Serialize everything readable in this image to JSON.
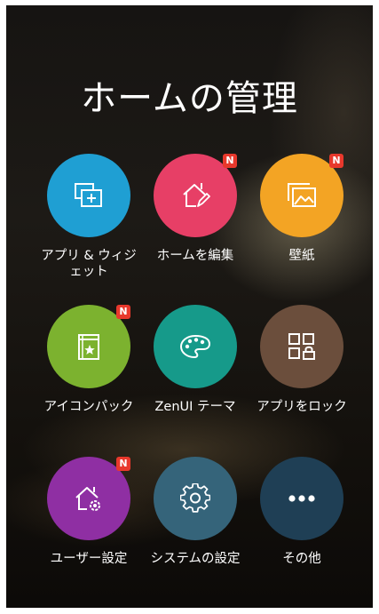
{
  "title": "ホームの管理",
  "badge_text": "N",
  "colors": {
    "apps_widgets": "#1f9fd3",
    "edit_home": "#e73f66",
    "wallpaper": "#f3a424",
    "icon_pack": "#7cb22f",
    "zenui_theme": "#169a8a",
    "lock_apps": "#6b4e3c",
    "user_settings": "#8f2fa3",
    "system_settings": "#35647a",
    "more": "#1f3f55",
    "badge": "#e8382c"
  },
  "tiles": [
    {
      "label": "アプリ & ウィジェット",
      "icon": "add-window-icon",
      "badge": false
    },
    {
      "label": "ホームを編集",
      "icon": "home-edit-icon",
      "badge": true
    },
    {
      "label": "壁紙",
      "icon": "wallpaper-icon",
      "badge": true
    },
    {
      "label": "アイコンパック",
      "icon": "icon-pack-book-icon",
      "badge": true
    },
    {
      "label": "ZenUI テーマ",
      "icon": "palette-icon",
      "badge": false
    },
    {
      "label": "アプリをロック",
      "icon": "grid-lock-icon",
      "badge": false
    },
    {
      "label": "ユーザー設定",
      "icon": "home-gear-icon",
      "badge": true
    },
    {
      "label": "システムの設定",
      "icon": "gear-icon",
      "badge": false
    },
    {
      "label": "その他",
      "icon": "more-dots-icon",
      "badge": false
    }
  ]
}
